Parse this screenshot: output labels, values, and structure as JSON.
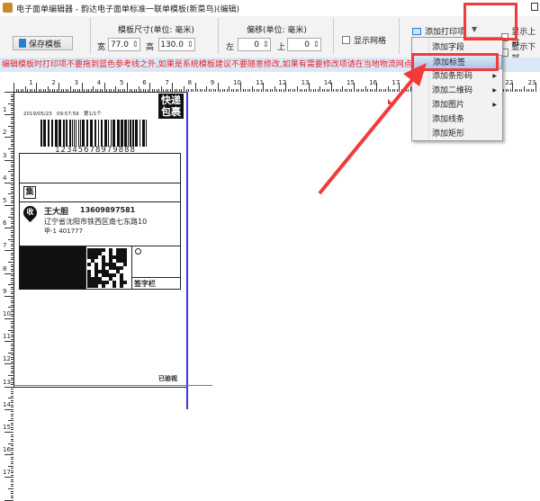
{
  "window": {
    "title": "电子面单编辑器 - 韵达电子面单标准一联单模板(新菜鸟)(编辑)"
  },
  "toolbar": {
    "save_label": "保存模板",
    "size_group": "模板尺寸(单位: 毫米)",
    "width_label": "宽",
    "width_value": "77.0",
    "height_label": "高",
    "height_value": "130.0",
    "offset_group": "偏移(单位: 毫米)",
    "left_label": "左",
    "left_value": "0",
    "top_label": "上",
    "top_value": "0",
    "show_grid": "显示网格",
    "add_item": "添加打印项",
    "show_top": "显示上部",
    "show_bottom": "显示下部"
  },
  "warning": "编辑模板时打印项不要拖到蓝色参考线之外,如果是系统模板建议不要随意修改,如果有需要修改项请在当地物流网点专人进行指导修改",
  "menu": {
    "items": [
      {
        "label": "添加字段",
        "sub": false
      },
      {
        "label": "添加标签",
        "sub": false,
        "highlighted": true
      },
      {
        "label": "添加条形码",
        "sub": true
      },
      {
        "label": "添加二维码",
        "sub": true
      },
      {
        "label": "添加图片",
        "sub": true
      },
      {
        "label": "添加线条",
        "sub": false
      },
      {
        "label": "添加矩形",
        "sub": false
      }
    ]
  },
  "label": {
    "badge": "快递包裹",
    "datetime": "2019/05/23   09:57:59   第1/1个",
    "barcode_number": "12345678979888",
    "ji": "集",
    "shou": "收",
    "name": "王大胆",
    "phone": "13609897581",
    "address1": "辽宁省沈阳市铁西区南七东路10",
    "address2": "甲-1  401777",
    "sign": "签字栏",
    "checked": "已验视"
  },
  "ruler": {
    "h": [
      "1",
      "2",
      "3",
      "4",
      "5",
      "6",
      "7",
      "8",
      "9",
      "10",
      "11",
      "12",
      "13",
      "14",
      "15",
      "16",
      "17",
      "18",
      "19",
      "20",
      "21",
      "22",
      "23"
    ],
    "v": [
      "1",
      "2",
      "3",
      "4",
      "5",
      "6",
      "7",
      "8",
      "9",
      "10",
      "11",
      "12",
      "13",
      "14",
      "15",
      "16",
      "17"
    ]
  },
  "colors": {
    "annotation": "#f23a3a",
    "guide": "#3b3bd6",
    "warning": "#e8232a"
  }
}
